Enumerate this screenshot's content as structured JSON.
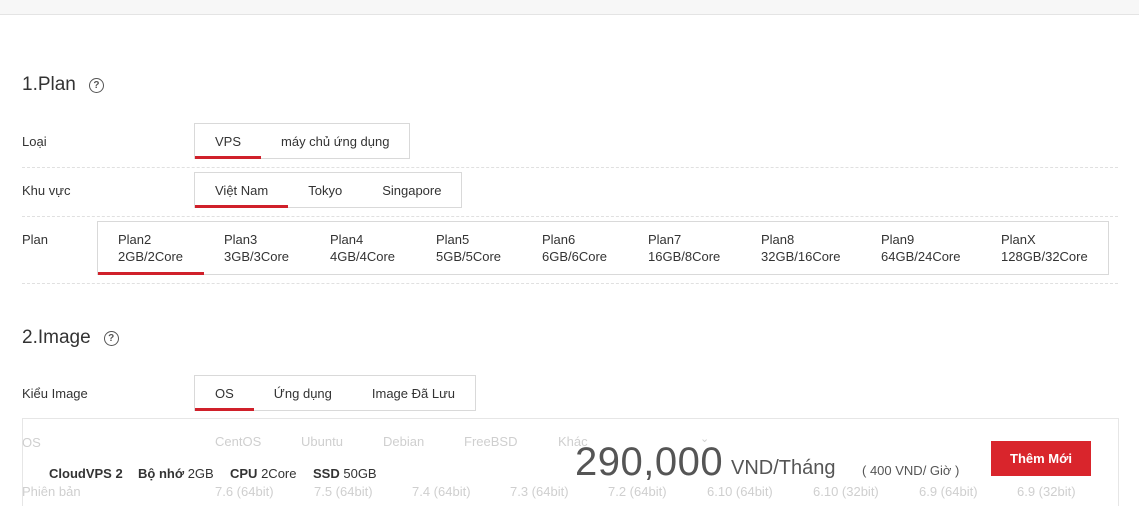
{
  "section1": {
    "title": "1.Plan"
  },
  "section2": {
    "title": "2.Image"
  },
  "help_icon": "?",
  "loai": {
    "label": "Loại",
    "options": [
      "VPS",
      "máy chủ ứng dụng"
    ]
  },
  "khu_vuc": {
    "label": "Khu vực",
    "options": [
      "Việt Nam",
      "Tokyo",
      "Singapore"
    ]
  },
  "plan": {
    "label": "Plan",
    "options": [
      {
        "name": "Plan2",
        "spec": "2GB/2Core"
      },
      {
        "name": "Plan3",
        "spec": "3GB/3Core"
      },
      {
        "name": "Plan4",
        "spec": "4GB/4Core"
      },
      {
        "name": "Plan5",
        "spec": "5GB/5Core"
      },
      {
        "name": "Plan6",
        "spec": "6GB/6Core"
      },
      {
        "name": "Plan7",
        "spec": "16GB/8Core"
      },
      {
        "name": "Plan8",
        "spec": "32GB/16Core"
      },
      {
        "name": "Plan9",
        "spec": "64GB/24Core"
      },
      {
        "name": "PlanX",
        "spec": "128GB/32Core"
      }
    ]
  },
  "kieu_image": {
    "label": "Kiểu Image",
    "options": [
      "OS",
      "Ứng dụng",
      "Image Đã Lưu"
    ]
  },
  "os": {
    "label": "OS",
    "options": [
      "CentOS",
      "Ubuntu",
      "Debian",
      "FreeBSD",
      "Khác"
    ]
  },
  "phien_ban": {
    "label": "Phiên bản",
    "options": [
      "7.6 (64bit)",
      "7.5 (64bit)",
      "7.4 (64bit)",
      "7.3 (64bit)",
      "7.2 (64bit)",
      "6.10 (64bit)",
      "6.10 (32bit)",
      "6.9 (64bit)",
      "6.9 (32bit)"
    ]
  },
  "summary": {
    "name": "CloudVPS 2",
    "mem_label": "Bộ nhớ",
    "mem_value": "2GB",
    "cpu_label": "CPU",
    "cpu_value": "2Core",
    "ssd_label": "SSD",
    "ssd_value": "50GB",
    "price": "290,000",
    "unit": "VND/Tháng",
    "per_hour": "( 400 VND/ Giờ )",
    "add_button": "Thêm Mới"
  }
}
